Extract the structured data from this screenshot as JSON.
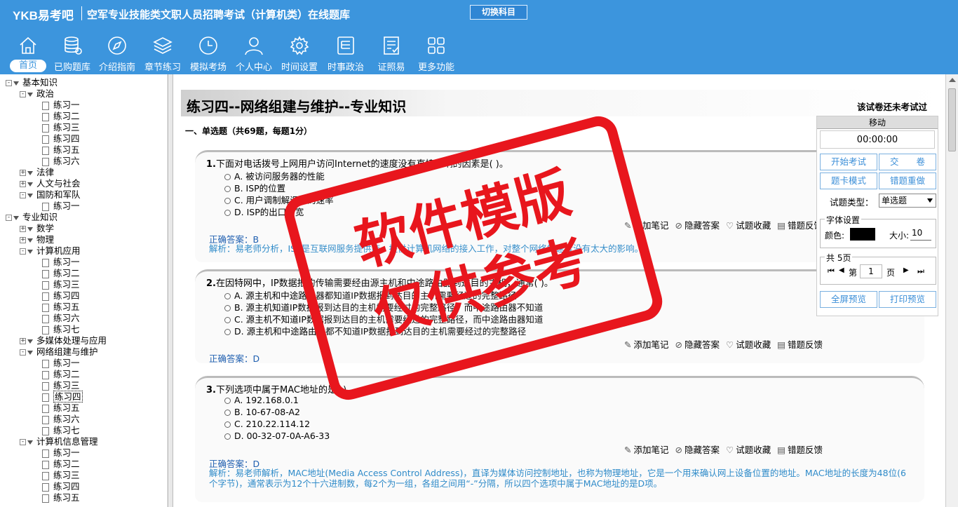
{
  "header": {
    "logo": "YKB易考吧",
    "title": "空军专业技能类文职人员招聘考试（计算机类）在线题库",
    "switch_label": "切换科目",
    "nav": [
      {
        "label": "首页",
        "icon": "home-icon"
      },
      {
        "label": "已购题库",
        "icon": "database-icon"
      },
      {
        "label": "介绍指南",
        "icon": "compass-icon"
      },
      {
        "label": "章节练习",
        "icon": "layers-icon"
      },
      {
        "label": "模拟考场",
        "icon": "clock-icon"
      },
      {
        "label": "个人中心",
        "icon": "user-icon"
      },
      {
        "label": "时间设置",
        "icon": "gear-icon"
      },
      {
        "label": "时事政治",
        "icon": "newspaper-icon"
      },
      {
        "label": "证照易",
        "icon": "checklist-icon"
      },
      {
        "label": "更多功能",
        "icon": "grid-icon"
      }
    ]
  },
  "tree": [
    {
      "label": "基本知识",
      "level": 0,
      "kind": "folder",
      "pm": "-"
    },
    {
      "label": "政治",
      "level": 1,
      "kind": "folder",
      "pm": "-"
    },
    {
      "label": "练习一",
      "level": 2,
      "kind": "doc"
    },
    {
      "label": "练习二",
      "level": 2,
      "kind": "doc"
    },
    {
      "label": "练习三",
      "level": 2,
      "kind": "doc"
    },
    {
      "label": "练习四",
      "level": 2,
      "kind": "doc"
    },
    {
      "label": "练习五",
      "level": 2,
      "kind": "doc"
    },
    {
      "label": "练习六",
      "level": 2,
      "kind": "doc"
    },
    {
      "label": "法律",
      "level": 1,
      "kind": "folder",
      "pm": "+"
    },
    {
      "label": "人文与社会",
      "level": 1,
      "kind": "folder",
      "pm": "+"
    },
    {
      "label": "国防和军队",
      "level": 1,
      "kind": "folder",
      "pm": "-"
    },
    {
      "label": "练习一",
      "level": 2,
      "kind": "doc"
    },
    {
      "label": "专业知识",
      "level": 0,
      "kind": "folder",
      "pm": "-"
    },
    {
      "label": "数学",
      "level": 1,
      "kind": "folder",
      "pm": "+"
    },
    {
      "label": "物理",
      "level": 1,
      "kind": "folder",
      "pm": "+"
    },
    {
      "label": "计算机应用",
      "level": 1,
      "kind": "folder",
      "pm": "-"
    },
    {
      "label": "练习一",
      "level": 2,
      "kind": "doc"
    },
    {
      "label": "练习二",
      "level": 2,
      "kind": "doc"
    },
    {
      "label": "练习三",
      "level": 2,
      "kind": "doc"
    },
    {
      "label": "练习四",
      "level": 2,
      "kind": "doc"
    },
    {
      "label": "练习五",
      "level": 2,
      "kind": "doc"
    },
    {
      "label": "练习六",
      "level": 2,
      "kind": "doc"
    },
    {
      "label": "练习七",
      "level": 2,
      "kind": "doc"
    },
    {
      "label": "多媒体处理与应用",
      "level": 1,
      "kind": "folder",
      "pm": "+"
    },
    {
      "label": "网络组建与维护",
      "level": 1,
      "kind": "folder",
      "pm": "-"
    },
    {
      "label": "练习一",
      "level": 2,
      "kind": "doc"
    },
    {
      "label": "练习二",
      "level": 2,
      "kind": "doc"
    },
    {
      "label": "练习三",
      "level": 2,
      "kind": "doc"
    },
    {
      "label": "练习四",
      "level": 2,
      "kind": "doc",
      "selected": true
    },
    {
      "label": "练习五",
      "level": 2,
      "kind": "doc"
    },
    {
      "label": "练习六",
      "level": 2,
      "kind": "doc"
    },
    {
      "label": "练习七",
      "level": 2,
      "kind": "doc"
    },
    {
      "label": "计算机信息管理",
      "level": 1,
      "kind": "folder",
      "pm": "-"
    },
    {
      "label": "练习一",
      "level": 2,
      "kind": "doc"
    },
    {
      "label": "练习二",
      "level": 2,
      "kind": "doc"
    },
    {
      "label": "练习三",
      "level": 2,
      "kind": "doc"
    },
    {
      "label": "练习四",
      "level": 2,
      "kind": "doc"
    },
    {
      "label": "练习五",
      "level": 2,
      "kind": "doc"
    }
  ],
  "paper": {
    "title": "练习四--网络组建与维护--专业知识",
    "status": "该试卷还未考试过",
    "section": "一、单选题（共69题，每题1分）"
  },
  "actions": {
    "note": "添加笔记",
    "hide": "隐藏答案",
    "fav": "试题收藏",
    "report": "错题反馈"
  },
  "questions": [
    {
      "num": "1.",
      "text": "下面对电话拨号上网用户访问Internet的速度没有直接影响的因素是(  )。",
      "options": [
        "A. 被访问服务器的性能",
        "B. ISP的位置",
        "C. 用户调制解调器的速率",
        "D. ISP的出口带宽"
      ],
      "answer": "正确答案：B",
      "explanation": "解析：易老师分析，ISP是互联网服务提供商，提供计算机网络的接入工作，对整个网络的速度没有太大的影响。"
    },
    {
      "num": "2.",
      "text": "在因特网中，IP数据报的传输需要经由源主机和中途路由器到达目的主机，通常(  )。",
      "options": [
        "A. 源主机和中途路由器都知道IP数据报到达目的主机需要经过的完整路径",
        "B. 源主机知道IP数据报到达目的主机需要经过的完整路径，而中途路由器不知道",
        "C. 源主机不知道IP数据报到达目的主机需要经过的完整路径，而中途路由器知道",
        "D. 源主机和中途路由器都不知道IP数据报到达目的主机需要经过的完整路径"
      ],
      "answer": "正确答案：D",
      "explanation": ""
    },
    {
      "num": "3.",
      "text": "下列选项中属于MAC地址的是(  )。",
      "options": [
        "A. 192.168.0.1",
        "B. 10-67-08-A2",
        "C. 210.22.114.12",
        "D. 00-32-07-0A-A6-33"
      ],
      "answer": "正确答案：D",
      "explanation": "解析：易老师解析，MAC地址(Media Access Control Address)，直译为媒体访问控制地址，也称为物理地址，它是一个用来确认网上设备位置的地址。MAC地址的长度为48位(6个字节)，通常表示为12个十六进制数，每2个为一组，各组之间用“-”分隔，所以四个选项中属于MAC地址的是D项。"
    }
  ],
  "side": {
    "move": "移动",
    "timer": "00:00:00",
    "start": "开始考试",
    "submit": "交　　卷",
    "card": "题卡模式",
    "redo": "错题重做",
    "type_label": "试题类型：",
    "type_value": "单选题",
    "font_legend": "字体设置",
    "color_label": "颜色:",
    "size_label": "大小:",
    "size_value": "10",
    "pages_legend": "共 5页",
    "page_prefix": "第",
    "page_value": "1",
    "page_suffix": "页",
    "fullscreen": "全屏预览",
    "print": "打印预览"
  },
  "watermark": {
    "line1": "软件模版",
    "line2": "仅供参考"
  },
  "colors": {
    "header": "#3c95dd",
    "stamp": "#e8161d",
    "answer": "#1f5fb0",
    "explanation": "#2f8bc9"
  }
}
